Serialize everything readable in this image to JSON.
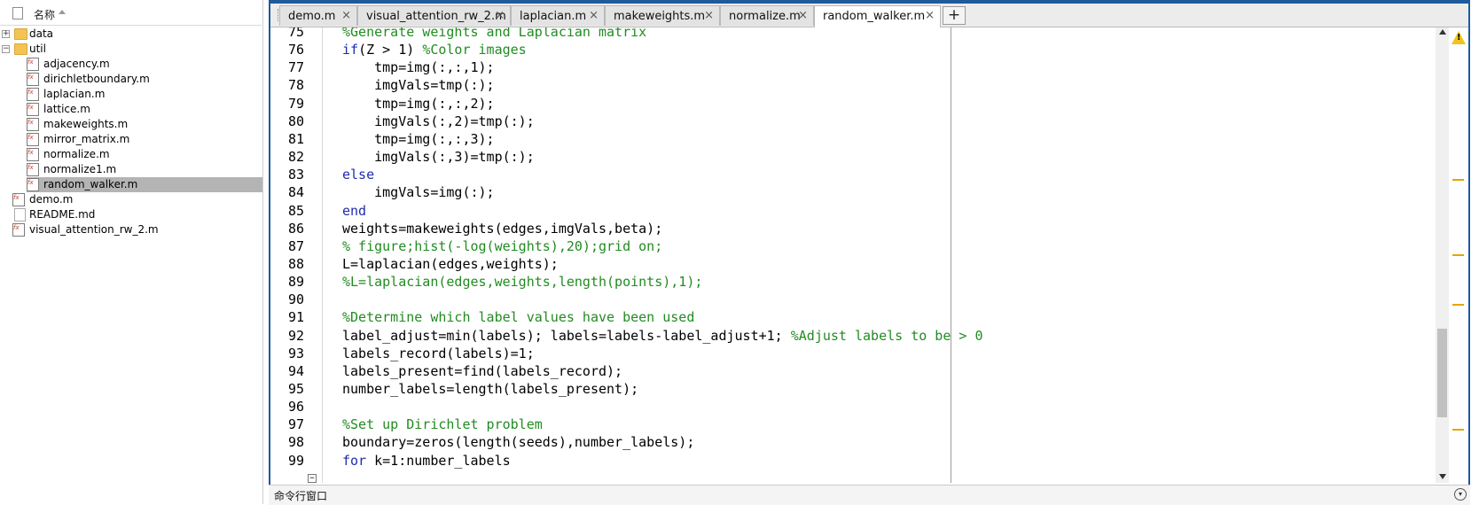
{
  "file_browser": {
    "header_label": "名称",
    "items": [
      {
        "label": "data",
        "type": "folder",
        "expander": "+"
      },
      {
        "label": "util",
        "type": "folder",
        "expander": "−"
      },
      {
        "label": "adjacency.m",
        "type": "mfile"
      },
      {
        "label": "dirichletboundary.m",
        "type": "mfile"
      },
      {
        "label": "laplacian.m",
        "type": "mfile"
      },
      {
        "label": "lattice.m",
        "type": "mfile"
      },
      {
        "label": "makeweights.m",
        "type": "mfile"
      },
      {
        "label": "mirror_matrix.m",
        "type": "mfile"
      },
      {
        "label": "normalize.m",
        "type": "mfile"
      },
      {
        "label": "normalize1.m",
        "type": "mfile"
      },
      {
        "label": "random_walker.m",
        "type": "mfile",
        "selected": true
      },
      {
        "label": "demo.m",
        "type": "mfile"
      },
      {
        "label": "README.md",
        "type": "md"
      },
      {
        "label": "visual_attention_rw_2.m",
        "type": "mfile"
      }
    ]
  },
  "editor": {
    "tabs": [
      {
        "label": "demo.m",
        "close": "×"
      },
      {
        "label": "visual_attention_rw_2.m",
        "close": "×"
      },
      {
        "label": "laplacian.m",
        "close": "×"
      },
      {
        "label": "makeweights.m",
        "close": "×"
      },
      {
        "label": "normalize.m",
        "close": "×"
      },
      {
        "label": "random_walker.m",
        "close": "×",
        "active": true
      }
    ],
    "new_tab": "+",
    "fold_marker": "−",
    "lines": [
      {
        "n": "75",
        "segs": [
          {
            "t": "%Generate weights and Laplacian matrix",
            "c": "comment"
          }
        ]
      },
      {
        "n": "76",
        "segs": [
          {
            "t": "if",
            "c": "kw"
          },
          {
            "t": "(Z > 1) ",
            "c": "code"
          },
          {
            "t": "%Color images",
            "c": "comment"
          }
        ]
      },
      {
        "n": "77",
        "segs": [
          {
            "t": "    tmp=img(:,:,1);",
            "c": "code"
          }
        ]
      },
      {
        "n": "78",
        "segs": [
          {
            "t": "    imgVals=tmp(:);",
            "c": "code"
          }
        ]
      },
      {
        "n": "79",
        "segs": [
          {
            "t": "    tmp=img(:,:,2);",
            "c": "code"
          }
        ]
      },
      {
        "n": "80",
        "segs": [
          {
            "t": "    imgVals(:,2)=tmp(:);",
            "c": "code"
          }
        ]
      },
      {
        "n": "81",
        "segs": [
          {
            "t": "    tmp=img(:,:,3);",
            "c": "code"
          }
        ]
      },
      {
        "n": "82",
        "segs": [
          {
            "t": "    imgVals(:,3)=tmp(:);",
            "c": "code"
          }
        ]
      },
      {
        "n": "83",
        "segs": [
          {
            "t": "else",
            "c": "kw"
          }
        ]
      },
      {
        "n": "84",
        "segs": [
          {
            "t": "    imgVals=img(:);",
            "c": "code"
          }
        ]
      },
      {
        "n": "85",
        "segs": [
          {
            "t": "end",
            "c": "kw"
          }
        ]
      },
      {
        "n": "86",
        "segs": [
          {
            "t": "weights=makeweights(edges,imgVals,beta);",
            "c": "code"
          }
        ]
      },
      {
        "n": "87",
        "segs": [
          {
            "t": "% figure;hist(-log(weights),20);grid on;",
            "c": "comment"
          }
        ]
      },
      {
        "n": "88",
        "segs": [
          {
            "t": "L=laplacian(edges,weights);",
            "c": "code"
          }
        ]
      },
      {
        "n": "89",
        "segs": [
          {
            "t": "%L=laplacian(edges,weights,length(points),1);",
            "c": "comment"
          }
        ]
      },
      {
        "n": "90",
        "segs": []
      },
      {
        "n": "91",
        "segs": [
          {
            "t": "%Determine which label values have been used",
            "c": "comment"
          }
        ]
      },
      {
        "n": "92",
        "segs": [
          {
            "t": "label_adjust=min(labels); labels=labels-label_adjust+1; ",
            "c": "code"
          },
          {
            "t": "%Adjust labels to be > 0",
            "c": "comment"
          }
        ]
      },
      {
        "n": "93",
        "segs": [
          {
            "t": "labels_record(labels)=1;",
            "c": "code"
          }
        ]
      },
      {
        "n": "94",
        "segs": [
          {
            "t": "labels_present=find(labels_record);",
            "c": "code"
          }
        ]
      },
      {
        "n": "95",
        "segs": [
          {
            "t": "number_labels=length(labels_present);",
            "c": "code"
          }
        ]
      },
      {
        "n": "96",
        "segs": []
      },
      {
        "n": "97",
        "segs": [
          {
            "t": "%Set up Dirichlet problem",
            "c": "comment"
          }
        ]
      },
      {
        "n": "98",
        "segs": [
          {
            "t": "boundary=zeros(length(seeds),number_labels);",
            "c": "code"
          }
        ]
      },
      {
        "n": "99",
        "segs": [
          {
            "t": "for",
            "c": "kw"
          },
          {
            "t": " k=1:number_labels",
            "c": "code"
          }
        ]
      }
    ],
    "warning_symbol": "!"
  },
  "command_window": {
    "title": "命令行窗口",
    "menu_symbol": "▾"
  }
}
